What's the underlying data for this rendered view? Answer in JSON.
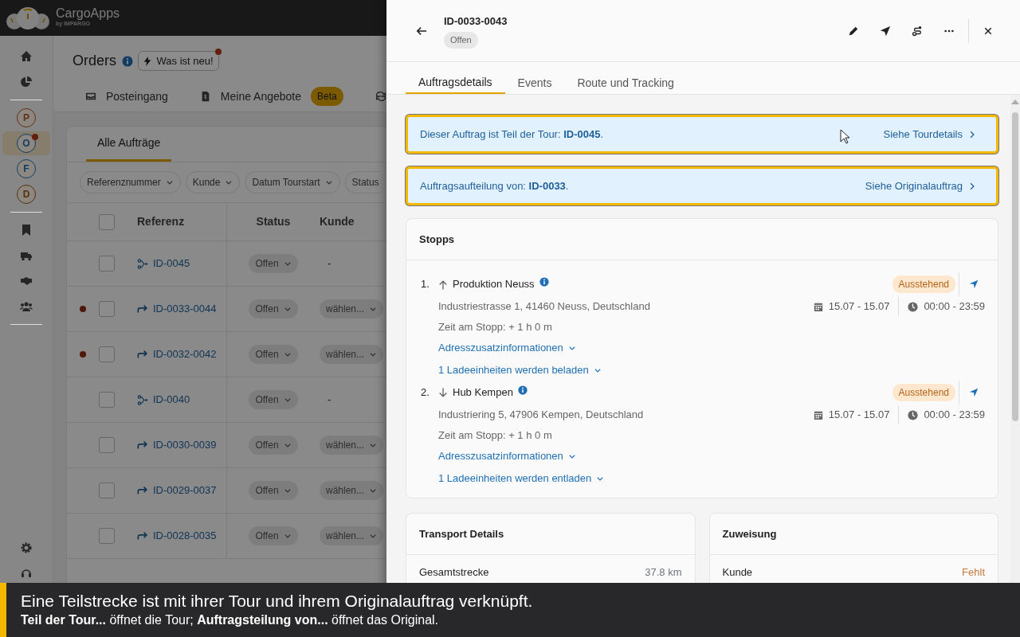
{
  "brand": {
    "name": "CargoApps",
    "sub": "by IMPARGO"
  },
  "sidebar": {
    "apps": [
      {
        "letter": "P",
        "color": "#632f17",
        "selected": false,
        "notification": false
      },
      {
        "letter": "O",
        "color": "#113d62",
        "selected": true,
        "notification": true
      },
      {
        "letter": "F",
        "color": "#113d62",
        "selected": false,
        "notification": false
      },
      {
        "letter": "D",
        "color": "#55310f",
        "selected": false,
        "notification": false
      }
    ]
  },
  "page": {
    "title": "Orders",
    "whats_new": "Was ist neu!",
    "whats_new_unread": true
  },
  "tabs": [
    {
      "label": "Posteingang",
      "selected": false
    },
    {
      "label": "Meine Angebote",
      "badge": "Beta",
      "selected": false
    }
  ],
  "list": {
    "tabs": [
      {
        "label": "Alle Aufträge",
        "selected": true
      }
    ],
    "filters": [
      "Referenznummer",
      "Kunde",
      "Datum Tourstart",
      "Status"
    ],
    "columns": [
      "Referenz",
      "Status",
      "Kunde"
    ],
    "select_all_checked": false,
    "rows": [
      {
        "unread": false,
        "checked": false,
        "kind": "tour",
        "ref": "ID-0045",
        "status": "Offen",
        "customer": {
          "kind": "text",
          "text": "-"
        }
      },
      {
        "unread": true,
        "checked": false,
        "kind": "split",
        "ref": "ID-0033-0044",
        "status": "Offen",
        "customer": {
          "kind": "select",
          "text": "wählen..."
        }
      },
      {
        "unread": true,
        "checked": false,
        "kind": "split",
        "ref": "ID-0032-0042",
        "status": "Offen",
        "customer": {
          "kind": "select",
          "text": "wählen..."
        }
      },
      {
        "unread": false,
        "checked": false,
        "kind": "tour",
        "ref": "ID-0040",
        "status": "Offen",
        "customer": {
          "kind": "text",
          "text": "-"
        }
      },
      {
        "unread": false,
        "checked": false,
        "kind": "split",
        "ref": "ID-0030-0039",
        "status": "Offen",
        "customer": {
          "kind": "select",
          "text": "wählen..."
        }
      },
      {
        "unread": false,
        "checked": false,
        "kind": "split",
        "ref": "ID-0029-0037",
        "status": "Offen",
        "customer": {
          "kind": "select",
          "text": "wählen..."
        }
      },
      {
        "unread": false,
        "checked": false,
        "kind": "split",
        "ref": "ID-0028-0035",
        "status": "Offen",
        "customer": {
          "kind": "select",
          "text": "wählen..."
        }
      }
    ]
  },
  "panel": {
    "id": "ID-0033-0043",
    "status": "Offen",
    "tabs": [
      {
        "label": "Auftragsdetails",
        "selected": true
      },
      {
        "label": "Events",
        "selected": false
      },
      {
        "label": "Route und Tracking",
        "selected": false
      }
    ],
    "notices": [
      {
        "text": "Dieser Auftrag ist Teil der Tour: **ID-0045**.",
        "link": "Siehe Tourdetails",
        "highlighted": true,
        "cursor": true
      },
      {
        "text": "Auftragsaufteilung von: **ID-0033**.",
        "link": "Siehe Originalauftrag",
        "highlighted": true,
        "cursor": false
      }
    ],
    "stops": {
      "title": "Stopps",
      "items": [
        {
          "number": "1.",
          "kind": "pickup",
          "name": "Produktion Neuss",
          "status": "Ausstehend",
          "address": "Industriestrasse 1, 41460 Neuss, Deutschland",
          "date": "15.07 - 15.07",
          "time": "00:00 - 23:59",
          "dwell": "Zeit am Stopp: + 1 h 0 m",
          "links": [
            "Adresszusatzinformationen",
            "1 Ladeeinheiten werden beladen"
          ]
        },
        {
          "number": "2.",
          "kind": "delivery",
          "name": "Hub Kempen",
          "status": "Ausstehend",
          "address": "Industriering 5, 47906 Kempen, Deutschland",
          "date": "15.07 - 15.07",
          "time": "00:00 - 23:59",
          "dwell": "Zeit am Stopp: + 1 h 0 m",
          "links": [
            "Adresszusatzinformationen",
            "1 Ladeeinheiten werden entladen"
          ]
        }
      ]
    },
    "cards": [
      {
        "title": "Transport Details",
        "rows": [
          {
            "label": "Gesamtstrecke",
            "value": "37.8 km",
            "missing": false
          }
        ]
      },
      {
        "title": "Zuweisung",
        "rows": [
          {
            "label": "Kunde",
            "value": "Fehlt",
            "missing": true
          }
        ]
      }
    ]
  },
  "caption": {
    "title": "Eine Teilstrecke ist mit ihrer Tour und ihrem Originalauftrag verknüpft.",
    "text": "**Teil der Tour...** öffnet die Tour; **Auftragsteilung von...** öffnet das Original."
  }
}
